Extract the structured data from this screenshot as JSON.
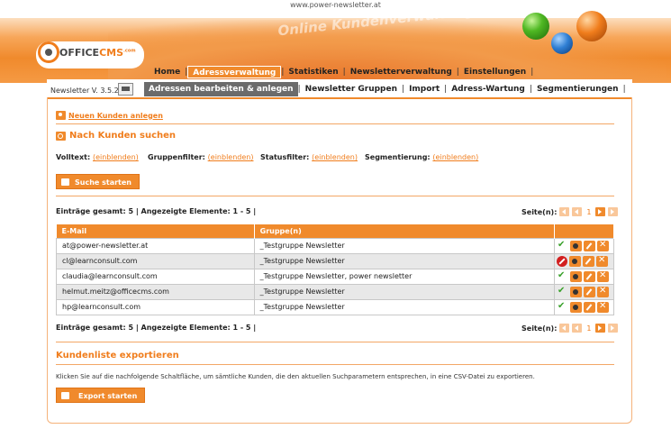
{
  "header": {
    "url": "www.power-newsletter.at",
    "tagline": "Online Kundenverwaltung",
    "logo": {
      "brand_a": "OFFICE",
      "brand_b": "CMS",
      "suffix": ".com"
    }
  },
  "main_nav": [
    {
      "label": "Home",
      "active": false
    },
    {
      "label": "Adressverwaltung",
      "active": true
    },
    {
      "label": "Statistiken",
      "active": false
    },
    {
      "label": "Newsletterverwaltung",
      "active": false
    },
    {
      "label": "Einstellungen",
      "active": false
    }
  ],
  "version": "Newsletter V. 3.5.2",
  "sub_nav": [
    {
      "label": "Adressen bearbeiten & anlegen",
      "active": true
    },
    {
      "label": "Newsletter Gruppen",
      "active": false
    },
    {
      "label": "Import",
      "active": false
    },
    {
      "label": "Adress-Wartung",
      "active": false
    },
    {
      "label": "Segmentierungen",
      "active": false
    }
  ],
  "new_customer_link": "Neuen Kunden anlegen",
  "search": {
    "title": "Nach Kunden suchen",
    "filters": [
      {
        "label": "Volltext:",
        "link": "(einblenden)"
      },
      {
        "label": "Gruppenfilter:",
        "link": "(einblenden)"
      },
      {
        "label": "Statusfilter:",
        "link": "(einblenden)"
      },
      {
        "label": "Segmentierung:",
        "link": "(einblenden)"
      }
    ],
    "button": "Suche starten"
  },
  "stats": {
    "text": "Einträge gesamt: 5  |  Angezeigte Elemente: 1 - 5  |",
    "pages_label": "Seite(n):",
    "current_page": "1"
  },
  "table": {
    "columns": [
      "E-Mail",
      "Gruppe(n)",
      ""
    ],
    "rows": [
      {
        "email": "at@power-newsletter.at",
        "groups": "_Testgruppe Newsletter",
        "status": "active"
      },
      {
        "email": "cl@learnconsult.com",
        "groups": "_Testgruppe Newsletter",
        "status": "blocked"
      },
      {
        "email": "claudia@learnconsult.com",
        "groups": "_Testgruppe Newsletter, power newsletter",
        "status": "active"
      },
      {
        "email": "helmut.meitz@officecms.com",
        "groups": "_Testgruppe Newsletter",
        "status": "active"
      },
      {
        "email": "hp@learnconsult.com",
        "groups": "_Testgruppe Newsletter",
        "status": "active"
      }
    ]
  },
  "export": {
    "title": "Kundenliste exportieren",
    "description": "Klicken Sie auf die nachfolgende Schaltfläche, um sämtliche Kunden, die den aktuellen Suchparametern entsprechen, in eine CSV-Datei zu exportieren.",
    "button": "Export starten"
  },
  "colors": {
    "accent": "#f08a2c",
    "accent_text": "#f07d1c",
    "active_subnav": "#6b6b6b"
  }
}
